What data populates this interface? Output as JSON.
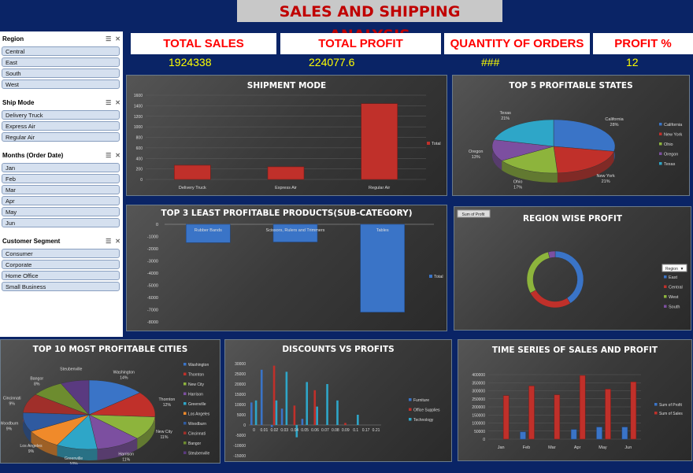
{
  "title": "SALES AND SHIPPING ANALYSIS",
  "slicers": [
    {
      "name": "Region",
      "items": [
        "Central",
        "East",
        "South",
        "West"
      ]
    },
    {
      "name": "Ship Mode",
      "items": [
        "Delivery Truck",
        "Express Air",
        "Regular Air"
      ]
    },
    {
      "name": "Months (Order Date)",
      "items": [
        "Jan",
        "Feb",
        "Mar",
        "Apr",
        "May",
        "Jun"
      ]
    },
    {
      "name": "Customer Segment",
      "items": [
        "Consumer",
        "Corporate",
        "Home Office",
        "Small Business"
      ]
    }
  ],
  "kpis": [
    {
      "label": "TOTAL SALES",
      "value": "1924338"
    },
    {
      "label": "TOTAL PROFIT",
      "value": "224077.6"
    },
    {
      "label": "QUANTITY OF ORDERS",
      "value": "###"
    },
    {
      "label": "PROFIT %",
      "value": "12"
    }
  ],
  "colors": {
    "red": "#c0302a",
    "blue": "#3a74c7",
    "green": "#8db43c",
    "purple": "#7c4fa0",
    "cyan": "#2ea6c8",
    "orange": "#f08a2a",
    "background": "#0a2466"
  },
  "chart_data": [
    {
      "type": "bar",
      "title": "SHIPMENT MODE",
      "categories": [
        "Delivery Truck",
        "Express Air",
        "Regular Air"
      ],
      "series": [
        {
          "name": "Total",
          "values": [
            270,
            240,
            1440
          ]
        }
      ],
      "yticks": [
        "0",
        "200",
        "400",
        "600",
        "800",
        "1000",
        "1200",
        "1400",
        "1600"
      ],
      "ylim": [
        0,
        1600
      ]
    },
    {
      "type": "pie",
      "title": "TOP 5 PROFITABLE STATES",
      "labels": [
        "California",
        "New York",
        "Ohio",
        "Oregon",
        "Texas"
      ],
      "values": [
        28,
        21,
        17,
        13,
        21
      ],
      "slice_labels": [
        "California 28%",
        "New York 21%",
        "Ohio 17%",
        "Oregon 13%",
        "Texas 21%"
      ]
    },
    {
      "type": "bar",
      "title": "TOP 3 LEAST PROFITABLE PRODUCTS(SUB-CATEGORY)",
      "categories": [
        "Rubber Bands",
        "Scissors, Rulers and Trimmers",
        "Tables"
      ],
      "series": [
        {
          "name": "Total",
          "values": [
            -1500,
            -1450,
            -7200
          ]
        }
      ],
      "yticks": [
        "0",
        "-1000",
        "-2000",
        "-3000",
        "-4000",
        "-5000",
        "-6000",
        "-7000",
        "-8000"
      ],
      "ylim": [
        -8000,
        0
      ]
    },
    {
      "type": "pie",
      "title": "REGION WISE PROFIT",
      "field_button": "Sum of Profit",
      "legend_button": "Region",
      "labels": [
        "East",
        "Central",
        "West",
        "South"
      ],
      "values": [
        41,
        26,
        29,
        4
      ]
    },
    {
      "type": "pie",
      "title": "TOP 10 MOST PROFITABLE CITIES",
      "labels": [
        "Washington",
        "Thornton",
        "New City",
        "Harrison",
        "Greenville",
        "Los Angeles",
        "Woodburn",
        "Cincinnati",
        "Bangor",
        "Steubenville"
      ],
      "values": [
        14,
        12,
        11,
        11,
        10,
        9,
        9,
        9,
        8,
        7
      ],
      "slice_labels": [
        "Washington 14%",
        "Thornton 12%",
        "New City 11%",
        "Harrison 11%",
        "Greenville 10%",
        "Los Angeles 9%",
        "Woodburn 9%",
        "Cincinnati 9%",
        "Bangor 8%",
        "Steubenville"
      ]
    },
    {
      "type": "bar",
      "title": "DISCOUNTS VS PROFITS",
      "categories": [
        "0",
        "0.01",
        "0.02",
        "0.03",
        "0.04",
        "0.05",
        "0.06",
        "0.07",
        "0.08",
        "0.09",
        "0.1",
        "0.17",
        "0.21"
      ],
      "series": [
        {
          "name": "Furniture",
          "values": [
            11000,
            27000,
            -1000,
            8000,
            0,
            3000,
            0,
            0,
            0,
            0,
            0,
            0,
            0
          ]
        },
        {
          "name": "Office Supplies",
          "values": [
            0,
            0,
            29000,
            0,
            9500,
            0,
            17000,
            0,
            0,
            1000,
            0,
            0,
            0
          ]
        },
        {
          "name": "Technology",
          "values": [
            12000,
            0,
            12000,
            26000,
            -6000,
            21000,
            9000,
            20000,
            12000,
            0,
            5000,
            0,
            0
          ]
        }
      ],
      "yticks": [
        "30000",
        "25000",
        "20000",
        "15000",
        "10000",
        "5000",
        "0",
        "-5000",
        "-10000",
        "-15000"
      ],
      "ylim": [
        -15000,
        30000
      ]
    },
    {
      "type": "bar",
      "title": "TIME SERIES OF SALES AND PROFIT",
      "categories": [
        "Jan",
        "Feb",
        "Mar",
        "Apr",
        "May",
        "Jun"
      ],
      "series": [
        {
          "name": "Sum of Profit",
          "values": [
            -15000,
            45000,
            -20000,
            60000,
            75000,
            75000
          ]
        },
        {
          "name": "Sum of Sales",
          "values": [
            270000,
            330000,
            275000,
            395000,
            310000,
            355000
          ]
        }
      ],
      "yticks": [
        "400000",
        "350000",
        "300000",
        "250000",
        "200000",
        "150000",
        "100000",
        "50000",
        "0"
      ],
      "ylim": [
        0,
        400000
      ]
    }
  ]
}
